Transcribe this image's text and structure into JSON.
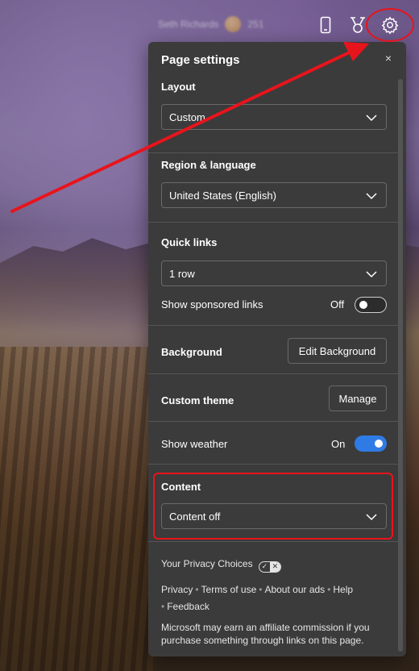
{
  "topbar": {
    "user_name": "Seth Richards",
    "points": "251",
    "icons": [
      "phone-icon",
      "trophy-icon",
      "gear-icon"
    ]
  },
  "panel": {
    "title": "Page settings",
    "close_symbol": "×",
    "layout": {
      "label": "Layout",
      "value": "Custom"
    },
    "region": {
      "label": "Region & language",
      "value": "United States (English)"
    },
    "quick_links": {
      "label": "Quick links",
      "value": "1 row",
      "sponsored_label": "Show sponsored links",
      "sponsored_state": "Off"
    },
    "background": {
      "label": "Background",
      "button": "Edit Background"
    },
    "custom_theme": {
      "label": "Custom theme",
      "button": "Manage"
    },
    "weather": {
      "label": "Show weather",
      "state": "On"
    },
    "content": {
      "label": "Content",
      "value": "Content off"
    },
    "footer": {
      "privacy_choices": "Your Privacy Choices",
      "links": [
        "Privacy",
        "Terms of use",
        "About our ads",
        "Help",
        "Feedback"
      ],
      "affiliate_notice": "Microsoft may earn an affiliate commission if you purchase something through links on this page."
    }
  },
  "colors": {
    "panel_bg": "#3b3b3b",
    "toggle_on": "#2f7be5",
    "annotation": "#e8141c"
  }
}
